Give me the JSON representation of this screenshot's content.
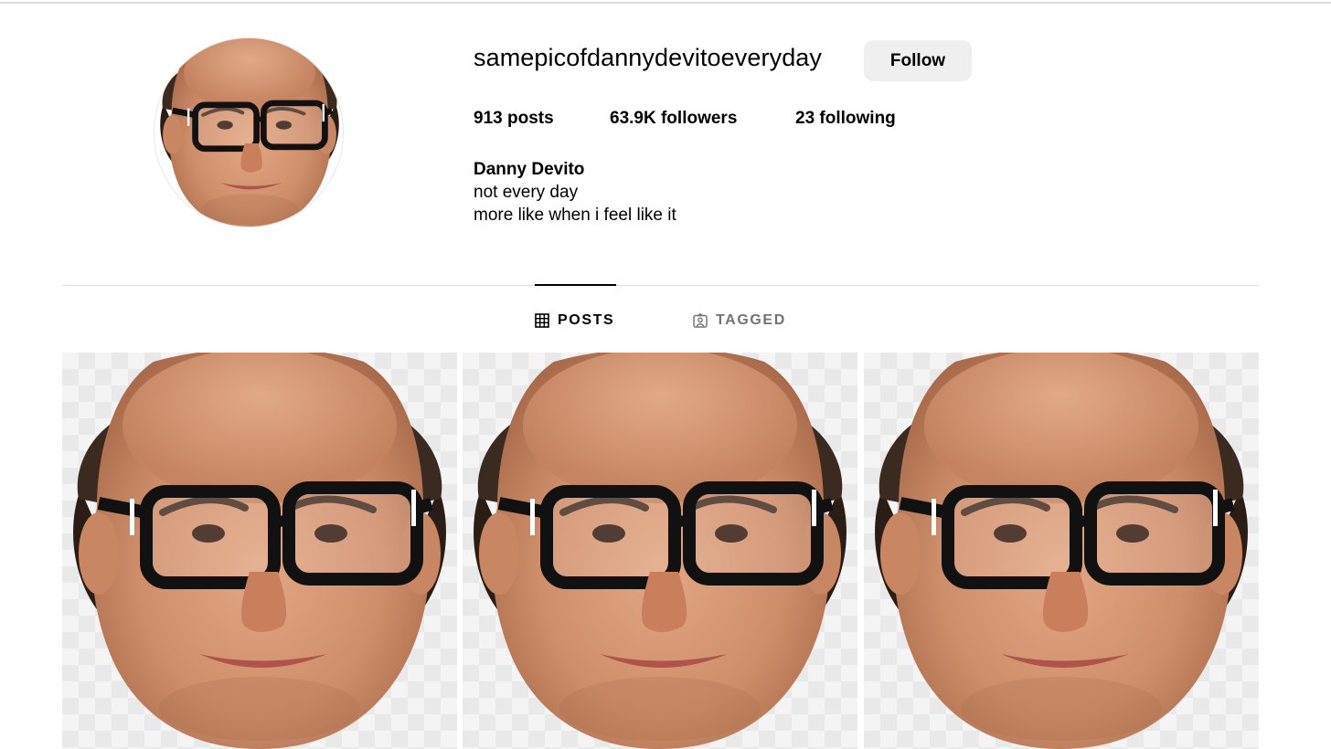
{
  "profile": {
    "username": "samepicofdannydevitoeveryday",
    "follow_label": "Follow",
    "stats": {
      "posts_count": "913",
      "posts_label": "posts",
      "followers_count": "63.9K",
      "followers_label": "followers",
      "following_count": "23",
      "following_label": "following"
    },
    "bio": {
      "name": "Danny Devito",
      "line1": "not every day",
      "line2": "more like when i feel like it"
    }
  },
  "tabs": [
    {
      "label": "POSTS",
      "icon": "grid-icon",
      "active": true
    },
    {
      "label": "TAGGED",
      "icon": "tagged-user-icon",
      "active": false
    }
  ],
  "posts": [
    {
      "image": "face-photo"
    },
    {
      "image": "face-photo"
    },
    {
      "image": "face-photo"
    }
  ],
  "colors": {
    "button_bg": "#efefef",
    "divider": "#dbdbdb",
    "inactive_tab": "#737373"
  }
}
